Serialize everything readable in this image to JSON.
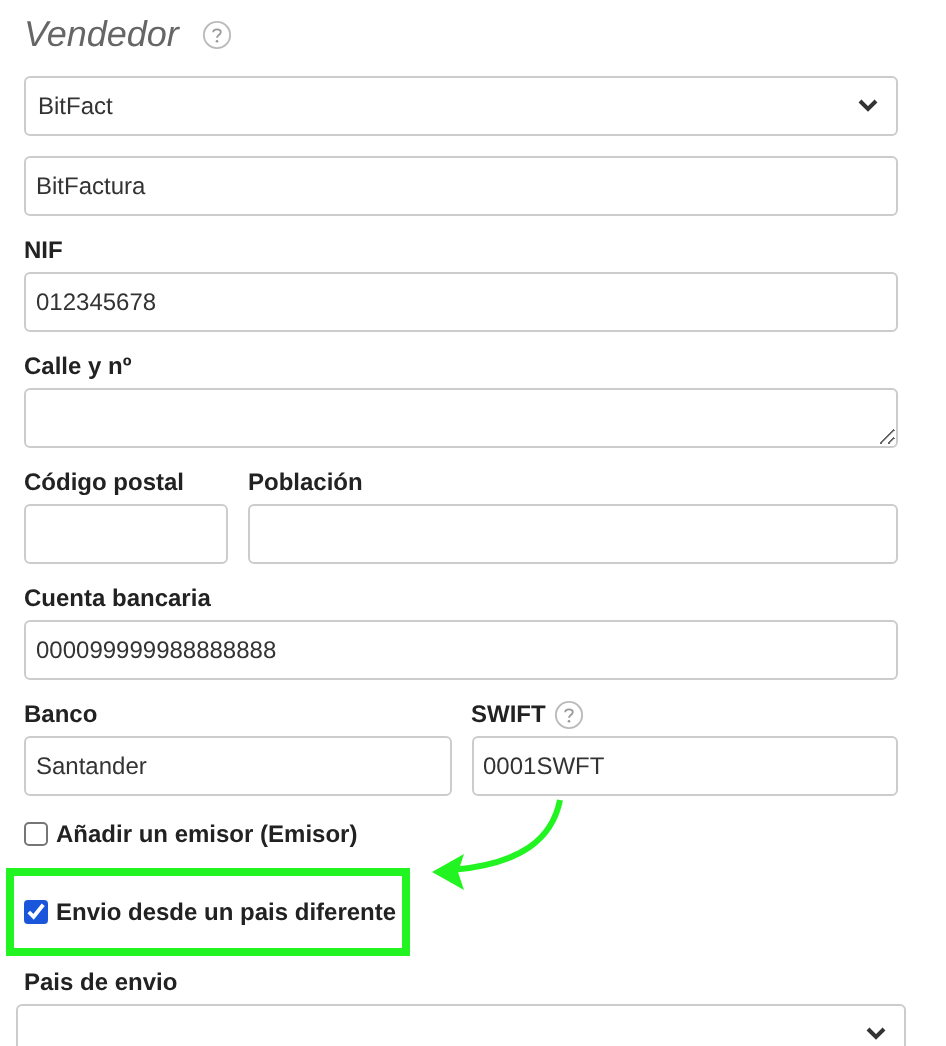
{
  "section": {
    "title": "Vendedor"
  },
  "seller_select": {
    "value": "BitFact"
  },
  "name_field": {
    "value": "BitFactura"
  },
  "nif": {
    "label": "NIF",
    "value": "012345678"
  },
  "street": {
    "label": "Calle y nº"
  },
  "postal_code": {
    "label": "Código postal"
  },
  "town": {
    "label": "Población"
  },
  "bank_account": {
    "label": "Cuenta bancaria",
    "value": "000099999988888888"
  },
  "bank": {
    "label": "Banco",
    "value": "Santander"
  },
  "swift": {
    "label": "SWIFT",
    "value": "0001SWFT"
  },
  "checkboxes": [
    {
      "label": "Añadir un emisor (Emisor)",
      "checked": false,
      "highlighted": false
    },
    {
      "label": "Envio desde un pais diferente",
      "checked": true,
      "highlighted": true
    }
  ],
  "shipping_country": {
    "label": "Pais de envio"
  }
}
